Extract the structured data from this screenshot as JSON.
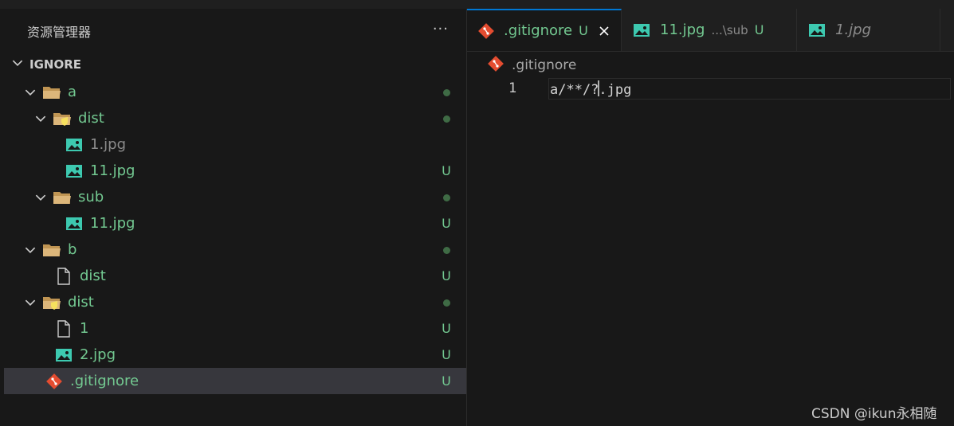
{
  "colors": {
    "background": "#181818",
    "selection": "#37373d",
    "git_untracked": "#73c991",
    "git_dot": "#3f6b45",
    "accent": "#0078d4",
    "image_icon": "#3dc9b0",
    "git_icon": "#e44c30",
    "folder": "#dcb67a"
  },
  "explorer": {
    "title": "资源管理器",
    "more_label": "···",
    "folder_name": "IGNORE",
    "items": [
      {
        "name": "a",
        "status": "dot",
        "icon": "folder-open-icon"
      },
      {
        "name": "dist",
        "status": "dot",
        "icon": "special-folder-open-icon"
      },
      {
        "name": "1.jpg",
        "status": "",
        "icon": "image-icon"
      },
      {
        "name": "11.jpg",
        "status": "U",
        "icon": "image-icon"
      },
      {
        "name": "sub",
        "status": "dot",
        "icon": "folder-open-icon"
      },
      {
        "name": "11.jpg",
        "status": "U",
        "icon": "image-icon"
      },
      {
        "name": "b",
        "status": "dot",
        "icon": "folder-open-icon"
      },
      {
        "name": "dist",
        "status": "U",
        "icon": "file-icon"
      },
      {
        "name": "dist",
        "status": "dot",
        "icon": "special-folder-open-icon"
      },
      {
        "name": "1",
        "status": "U",
        "icon": "file-icon"
      },
      {
        "name": "2.jpg",
        "status": "U",
        "icon": "image-icon"
      },
      {
        "name": ".gitignore",
        "status": "U",
        "icon": "git-icon"
      }
    ]
  },
  "tabs": [
    {
      "name": ".gitignore",
      "status": "U",
      "desc": "",
      "active": true,
      "icon": "git-icon"
    },
    {
      "name": "11.jpg",
      "status": "U",
      "desc": "...\\sub",
      "active": false,
      "icon": "image-icon"
    },
    {
      "name": "1.jpg",
      "status": "",
      "desc": "",
      "active": false,
      "icon": "image-icon"
    }
  ],
  "breadcrumb": {
    "file": ".gitignore"
  },
  "editor": {
    "line_number": "1",
    "code_before_caret": "a/**/?",
    "code_after_caret": ".jpg"
  },
  "watermark": "CSDN @ikun永相随"
}
